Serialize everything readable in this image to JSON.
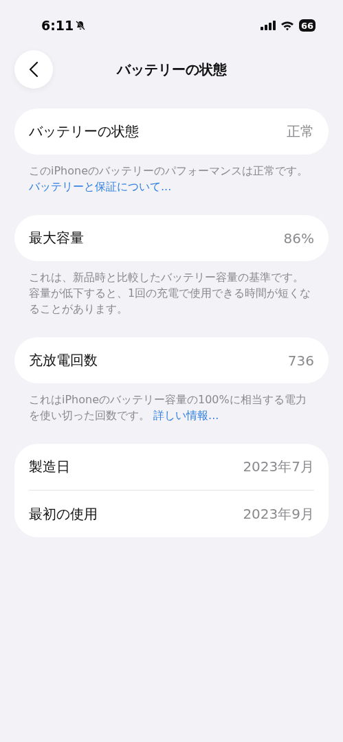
{
  "status_bar": {
    "time": "6:11",
    "battery": "66"
  },
  "nav": {
    "title": "バッテリーの状態"
  },
  "sections": [
    {
      "rows": [
        {
          "label": "バッテリーの状態",
          "value": "正常"
        }
      ],
      "footer": {
        "text": "このiPhoneのバッテリーのパフォーマンスは正常です。",
        "link": "バッテリーと保証について..."
      }
    },
    {
      "rows": [
        {
          "label": "最大容量",
          "value": "86%"
        }
      ],
      "footer": {
        "text": "これは、新品時と比較したバッテリー容量の基準です。容量が低下すると、1回の充電で使用できる時間が短くなることがあります。"
      }
    },
    {
      "rows": [
        {
          "label": "充放電回数",
          "value": "736"
        }
      ],
      "footer": {
        "text": "これはiPhoneのバッテリー容量の100%に相当する電力を使い切った回数です。",
        "link": "詳しい情報..."
      }
    },
    {
      "rows": [
        {
          "label": "製造日",
          "value": "2023年7月"
        },
        {
          "label": "最初の使用",
          "value": "2023年9月"
        }
      ]
    }
  ]
}
